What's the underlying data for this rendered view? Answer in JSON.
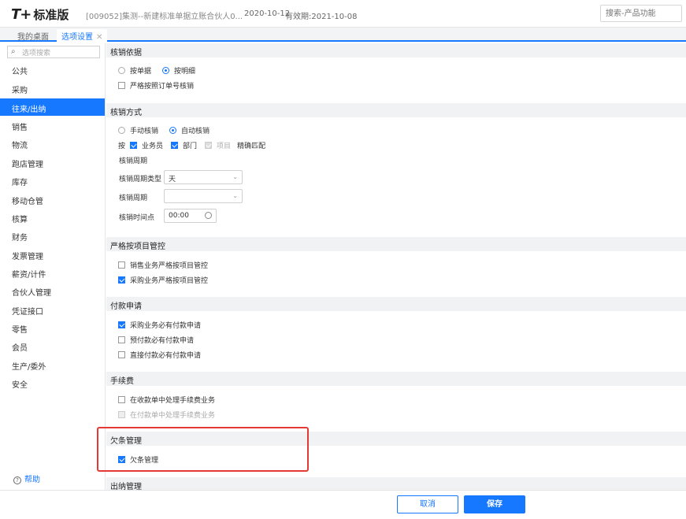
{
  "header": {
    "logo_text": "T+",
    "edition": "标准版",
    "account": "[009052]集测--新建标准单据立账合伙人0...",
    "date_start": "2020-10-12",
    "date_end": "有效期:2021-10-08",
    "search_placeholder": "搜索-产品功能"
  },
  "tabs": [
    {
      "label": "我的桌面"
    },
    {
      "label": "选项设置"
    }
  ],
  "sidebar": {
    "search_placeholder": "选项搜索",
    "items": [
      {
        "label": "公共"
      },
      {
        "label": "采购"
      },
      {
        "label": "往来/出纳"
      },
      {
        "label": "销售"
      },
      {
        "label": "物流"
      },
      {
        "label": "跑店管理"
      },
      {
        "label": "库存"
      },
      {
        "label": "移动仓管"
      },
      {
        "label": "核算"
      },
      {
        "label": "财务"
      },
      {
        "label": "发票管理"
      },
      {
        "label": "薪资/计件"
      },
      {
        "label": "合伙人管理"
      },
      {
        "label": "凭证接口"
      },
      {
        "label": "零售"
      },
      {
        "label": "会员"
      },
      {
        "label": "生产/委外"
      },
      {
        "label": "安全"
      }
    ],
    "active_index": 2,
    "help_label": "帮助"
  },
  "sections": {
    "basis": {
      "title": "核销依据",
      "radio_by_doc": "按单据",
      "radio_by_detail": "按明细",
      "strict_order": "严格按照订单号核销"
    },
    "method": {
      "title": "核销方式",
      "radio_manual": "手动核销",
      "radio_auto": "自动核销",
      "by_label": "按",
      "cb_salesman": "业务员",
      "cb_dept": "部门",
      "cb_project": "项目",
      "exact_match": "精确匹配",
      "period_heading": "核销周期",
      "period_type_label": "核销周期类型",
      "period_type_value": "天",
      "period_label": "核销周期",
      "period_value": "",
      "time_label": "核销时间点",
      "time_value": "00:00"
    },
    "project_control": {
      "title": "严格按项目管控",
      "sales": "销售业务严格按项目管控",
      "purchase": "采购业务严格按项目管控"
    },
    "payment_request": {
      "title": "付款申请",
      "purchase_required": "采购业务必有付款申请",
      "prepay_required": "预付款必有付款申请",
      "direct_required": "直接付款必有付款申请"
    },
    "fees": {
      "title": "手续费",
      "in_receipt": "在收款单中处理手续费业务",
      "in_payment": "在付款单中处理手续费业务"
    },
    "debt": {
      "title": "欠条管理",
      "checkbox": "欠条管理"
    },
    "cashier": {
      "title": "出纳管理"
    }
  },
  "footer": {
    "cancel_label": "取消",
    "save_label": "保存"
  },
  "colors": {
    "accent": "#1677ff",
    "highlight_border": "#e53935"
  }
}
